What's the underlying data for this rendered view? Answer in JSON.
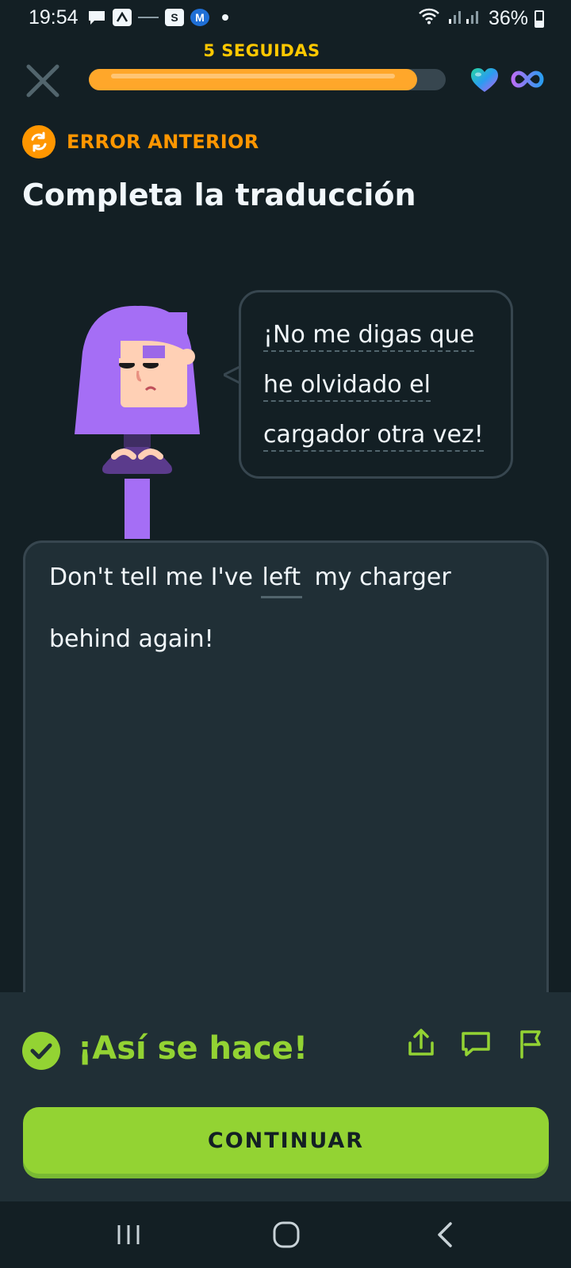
{
  "status_bar": {
    "time": "19:54",
    "battery": "36%",
    "icons": [
      "message-icon",
      "app-icon-a",
      "app-icon-news",
      "app-icon-s",
      "app-icon-m",
      "dot-icon"
    ]
  },
  "header": {
    "streak_label": "5 SEGUIDAS",
    "progress_fraction": 0.92
  },
  "mistake_label": "ERROR ANTERIOR",
  "page_title": "Completa la traducción",
  "speech_bubble": {
    "lines": [
      "¡No me digas que",
      "he olvidado el",
      "cargador otra vez!"
    ]
  },
  "answer": {
    "line1_before": "Don't tell me I've",
    "blank_word": "left",
    "line1_after": "my charger",
    "line2": "behind again!"
  },
  "feedback": {
    "message": "¡Así se hace!",
    "continue_label": "CONTINUAR"
  },
  "colors": {
    "background": "#131f24",
    "accent_orange": "#ff9600",
    "progress": "#ffa72a",
    "success_green": "#93d333",
    "character_purple": "#a56ef5"
  }
}
